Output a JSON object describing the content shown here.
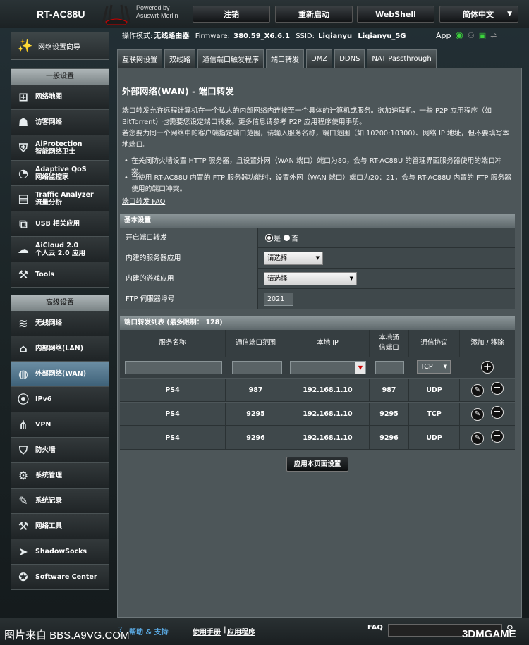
{
  "header": {
    "model": "RT-AC88U",
    "powered_by": "Powered by",
    "firmware_brand": "Asuswrt-Merlin",
    "logout": "注销",
    "reboot": "重新启动",
    "webshell": "WebShell",
    "language": "简体中文"
  },
  "status": {
    "mode_label": "操作模式:",
    "mode": "无线路由器",
    "firmware_label": "Firmware:",
    "firmware": "380.59_X6.6.1",
    "ssid_label": "SSID:",
    "ssid1": "Liqianyu",
    "ssid2": "Liqianyu_5G",
    "app": "App"
  },
  "sidebar": {
    "qis": "网络设置向导",
    "general_title": "一般设置",
    "general": [
      {
        "label": "网络地图",
        "icon": "network-map-icon"
      },
      {
        "label": "访客网络",
        "icon": "guest-network-icon"
      },
      {
        "label": "AiProtection\n智能网络卫士",
        "icon": "aiprotection-icon"
      },
      {
        "label": "Adaptive QoS\n网络监控家",
        "icon": "qos-icon"
      },
      {
        "label": "Traffic Analyzer\n流量分析",
        "icon": "traffic-analyzer-icon"
      },
      {
        "label": "USB 相关应用",
        "icon": "usb-icon"
      },
      {
        "label": "AiCloud 2.0\n个人云 2.0 应用",
        "icon": "aicloud-icon"
      },
      {
        "label": "Tools",
        "icon": "tools-icon"
      }
    ],
    "advanced_title": "高级设置",
    "advanced": [
      {
        "label": "无线网络",
        "icon": "wireless-icon"
      },
      {
        "label": "内部网络(LAN)",
        "icon": "lan-icon"
      },
      {
        "label": "外部网络(WAN)",
        "icon": "wan-icon"
      },
      {
        "label": "IPv6",
        "icon": "ipv6-icon"
      },
      {
        "label": "VPN",
        "icon": "vpn-icon"
      },
      {
        "label": "防火墙",
        "icon": "firewall-icon"
      },
      {
        "label": "系统管理",
        "icon": "admin-icon"
      },
      {
        "label": "系统记录",
        "icon": "syslog-icon"
      },
      {
        "label": "网络工具",
        "icon": "network-tools-icon"
      },
      {
        "label": "ShadowSocks",
        "icon": "shadowsocks-icon"
      },
      {
        "label": "Software Center",
        "icon": "software-center-icon"
      }
    ]
  },
  "tabs": [
    "互联网设置",
    "双线路",
    "通信端口触发程序",
    "端口转发",
    "DMZ",
    "DDNS",
    "NAT Passthrough"
  ],
  "page": {
    "title": "外部网络(WAN) - 端口转发",
    "desc1": "端口转发允许远程计算机在一个私人的内部网络内连接至一个具体的计算机或服务。欲加速联机，一些 P2P 应用程序（如 BitTorrent）也需要您设定端口转发。更多信息请参考 P2P 应用程序使用手册。",
    "desc2": "若您要为同一个网络中的客户端指定端口范围，请输入服务名称，端口范围（如 10200:10300）、网络 IP 地址，但不要填写本地端口。",
    "bullet1": "在关闭防火墙设置 HTTP 服务器，且设置外网（WAN 端口）端口为80，会与 RT-AC88U 的管理界面服务器使用的端口冲突。",
    "bullet2": "当使用 RT-AC88U 内置的 FTP 服务器功能时，设置外网（WAN 端口）端口为20：21，会与 RT-AC88U 内置的 FTP 服务器使用的端口冲突。",
    "faq": "端口转发  FAQ"
  },
  "basic": {
    "title": "基本设置",
    "enable_label": "开启端口转发",
    "yes": "是",
    "no": "否",
    "server_label": "内建的服务器应用",
    "server_value": "请选择",
    "game_label": "内建的游戏应用",
    "game_value": "请选择",
    "ftp_label": "FTP 伺服器埠号",
    "ftp_value": "2021"
  },
  "list": {
    "title": "端口转发列表 (最多限制： 128)",
    "headers": [
      "服务名称",
      "通信端口范围",
      "本地 IP",
      "本地通信端口",
      "通信协议",
      "添加 / 移除"
    ],
    "proto_default": "TCP",
    "rows": [
      {
        "service": "PS4",
        "port": "987",
        "ip": "192.168.1.10",
        "local": "987",
        "proto": "UDP"
      },
      {
        "service": "PS4",
        "port": "9295",
        "ip": "192.168.1.10",
        "local": "9295",
        "proto": "TCP"
      },
      {
        "service": "PS4",
        "port": "9296",
        "ip": "192.168.1.10",
        "local": "9296",
        "proto": "UDP"
      }
    ]
  },
  "apply": "应用本页面设置",
  "footer": {
    "help": "帮助 & 支持",
    "manual": "使用手册",
    "utility": "应用程序",
    "faq": "FAQ",
    "watermark1": "图片来自 BBS.A9VG.COM",
    "watermark2": "3DMGAME"
  }
}
